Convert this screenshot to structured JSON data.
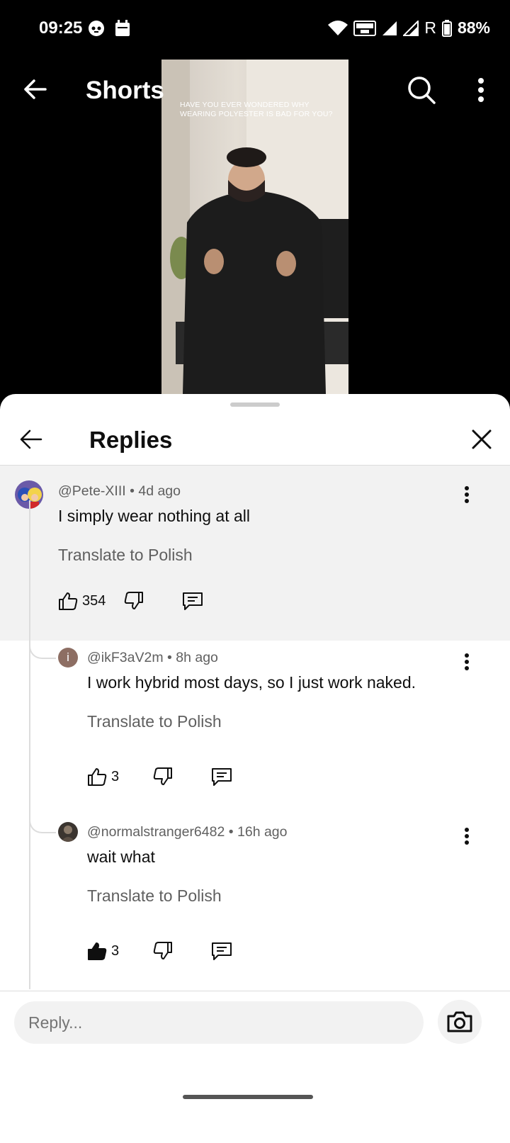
{
  "status_bar": {
    "time": "09:25",
    "battery": "88%",
    "network_label": "R",
    "volte_label": "VOLTE"
  },
  "top_bar": {
    "title": "Shorts"
  },
  "video": {
    "caption": "HAVE YOU EVER WONDERED WHY WEARING POLYESTER IS BAD FOR YOU?"
  },
  "sheet": {
    "title": "Replies"
  },
  "comments": [
    {
      "author": "@Pete-XIII",
      "age": "4d ago",
      "text": "I simply wear nothing at all",
      "translate": "Translate to Polish",
      "likes": "354",
      "avatar_icon": "anime-avatar"
    },
    {
      "author": "@ikF3aV2m",
      "age": "8h ago",
      "text": "I work hybrid most days, so I just work naked.",
      "translate": "Translate to Polish",
      "likes": "3",
      "avatar_letter": "i",
      "avatar_color": "#8d6e63"
    },
    {
      "author": "@normalstranger6482",
      "age": "16h ago",
      "text": "wait what",
      "translate": "Translate to Polish",
      "likes": "3",
      "liked": true,
      "avatar_icon": "photo-avatar"
    }
  ],
  "reply_bar": {
    "placeholder": "Reply..."
  },
  "separator": "•"
}
